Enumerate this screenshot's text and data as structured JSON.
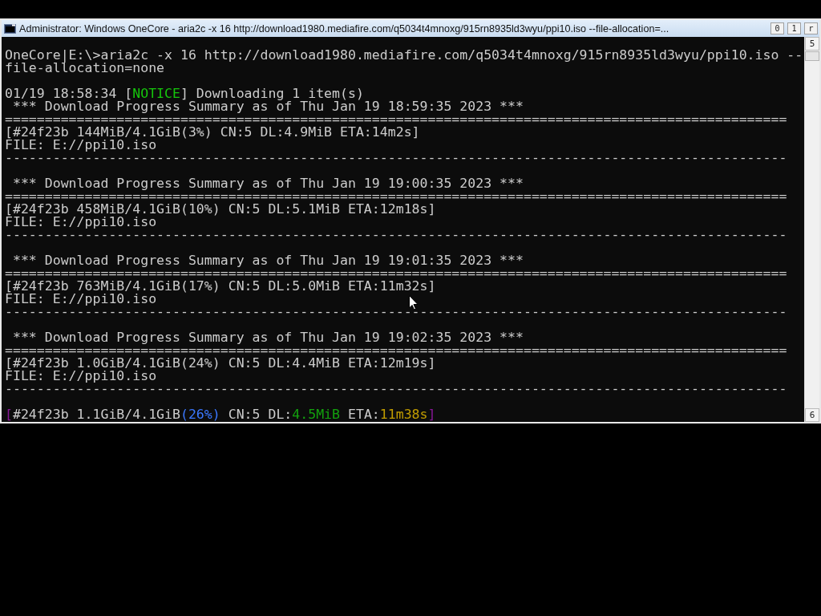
{
  "window": {
    "title": "Administrator:  Windows OneCore - aria2c  -x 16 http://download1980.mediafire.com/q5034t4mnoxg/915rn8935ld3wyu/ppi10.iso --file-allocation=...",
    "title_buttons": [
      "0",
      "1",
      "r"
    ]
  },
  "console": {
    "lines": [
      {
        "kind": "text",
        "segments": [
          {
            "text": "OneCore|E:\\>aria2c -x 16 http://download1980.mediafire.com/q5034t4mnoxg/915rn8935ld3wyu/ppi10.iso --"
          }
        ]
      },
      {
        "kind": "text",
        "segments": [
          {
            "text": "file-allocation=none"
          }
        ]
      },
      {
        "kind": "blank"
      },
      {
        "kind": "text",
        "segments": [
          {
            "text": "01/19 18:58:34 ["
          },
          {
            "text": "NOTICE",
            "color": "#16c60c"
          },
          {
            "text": "] Downloading 1 item(s)"
          }
        ]
      },
      {
        "kind": "text",
        "segments": [
          {
            "text": " *** Download Progress Summary as of Thu Jan 19 18:59:35 2023 ***"
          }
        ]
      },
      {
        "kind": "text",
        "segments": [
          {
            "text": "=================================================================================================="
          }
        ]
      },
      {
        "kind": "text",
        "segments": [
          {
            "text": "[#24f23b 144MiB/4.1GiB(3%) CN:5 DL:4.9MiB ETA:14m2s]"
          }
        ]
      },
      {
        "kind": "text",
        "segments": [
          {
            "text": "FILE: E://ppi10.iso"
          }
        ]
      },
      {
        "kind": "text",
        "segments": [
          {
            "text": "--------------------------------------------------------------------------------------------------"
          }
        ]
      },
      {
        "kind": "blank"
      },
      {
        "kind": "text",
        "segments": [
          {
            "text": " *** Download Progress Summary as of Thu Jan 19 19:00:35 2023 ***"
          }
        ]
      },
      {
        "kind": "text",
        "segments": [
          {
            "text": "=================================================================================================="
          }
        ]
      },
      {
        "kind": "text",
        "segments": [
          {
            "text": "[#24f23b 458MiB/4.1GiB(10%) CN:5 DL:5.1MiB ETA:12m18s]"
          }
        ]
      },
      {
        "kind": "text",
        "segments": [
          {
            "text": "FILE: E://ppi10.iso"
          }
        ]
      },
      {
        "kind": "text",
        "segments": [
          {
            "text": "--------------------------------------------------------------------------------------------------"
          }
        ]
      },
      {
        "kind": "blank"
      },
      {
        "kind": "text",
        "segments": [
          {
            "text": " *** Download Progress Summary as of Thu Jan 19 19:01:35 2023 ***"
          }
        ]
      },
      {
        "kind": "text",
        "segments": [
          {
            "text": "=================================================================================================="
          }
        ]
      },
      {
        "kind": "text",
        "segments": [
          {
            "text": "[#24f23b 763MiB/4.1GiB(17%) CN:5 DL:5.0MiB ETA:11m32s]"
          }
        ]
      },
      {
        "kind": "text",
        "segments": [
          {
            "text": "FILE: E://ppi10.iso"
          }
        ]
      },
      {
        "kind": "text",
        "segments": [
          {
            "text": "--------------------------------------------------------------------------------------------------"
          }
        ]
      },
      {
        "kind": "blank"
      },
      {
        "kind": "text",
        "segments": [
          {
            "text": " *** Download Progress Summary as of Thu Jan 19 19:02:35 2023 ***"
          }
        ]
      },
      {
        "kind": "text",
        "segments": [
          {
            "text": "=================================================================================================="
          }
        ]
      },
      {
        "kind": "text",
        "segments": [
          {
            "text": "[#24f23b 1.0GiB/4.1GiB(24%) CN:5 DL:4.4MiB ETA:12m19s]"
          }
        ]
      },
      {
        "kind": "text",
        "segments": [
          {
            "text": "FILE: E://ppi10.iso"
          }
        ]
      },
      {
        "kind": "text",
        "segments": [
          {
            "text": "--------------------------------------------------------------------------------------------------"
          }
        ]
      },
      {
        "kind": "blank"
      },
      {
        "kind": "text",
        "segments": [
          {
            "text": "[",
            "color": "#881798"
          },
          {
            "text": "#24f23b 1.1GiB/4.1GiB"
          },
          {
            "text": "(26%)",
            "color": "#3b78ff"
          },
          {
            "text": " CN:5 DL:"
          },
          {
            "text": "4.5MiB",
            "color": "#13a10e"
          },
          {
            "text": " ETA:"
          },
          {
            "text": "11m38s",
            "color": "#c19c00"
          },
          {
            "text": "]",
            "color": "#881798"
          }
        ]
      }
    ]
  },
  "scrollbar": {
    "up_button": "5",
    "down_button": "6"
  }
}
